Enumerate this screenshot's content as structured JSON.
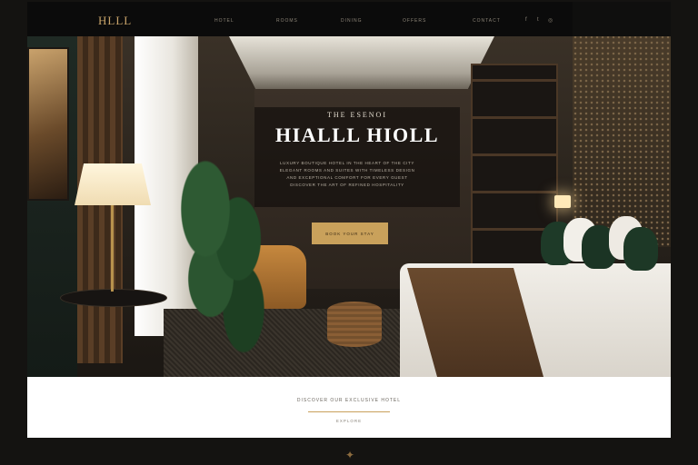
{
  "header": {
    "logo": "HLLL",
    "nav": [
      "HOTEL",
      "ROOMS",
      "DINING",
      "OFFERS",
      "CONTACT"
    ],
    "social": [
      "f",
      "t",
      "◎"
    ]
  },
  "hero": {
    "eyebrow": "THE ESENOI",
    "title": "HIALLL HIOLL",
    "text_lines": [
      "LUXURY BOUTIQUE HOTEL IN THE HEART OF THE CITY",
      "ELEGANT ROOMS AND SUITES WITH TIMELESS DESIGN",
      "AND EXCEPTIONAL COMFORT FOR EVERY GUEST",
      "DISCOVER THE ART OF REFINED HOSPITALITY"
    ],
    "cta_label": "BOOK YOUR STAY"
  },
  "footer": {
    "text": "DISCOVER OUR EXCLUSIVE HOTEL",
    "link": "EXPLORE"
  },
  "colors": {
    "accent_gold": "#c9a15b",
    "dark_bg": "#0b0b0b",
    "light_band": "#ffffff"
  }
}
